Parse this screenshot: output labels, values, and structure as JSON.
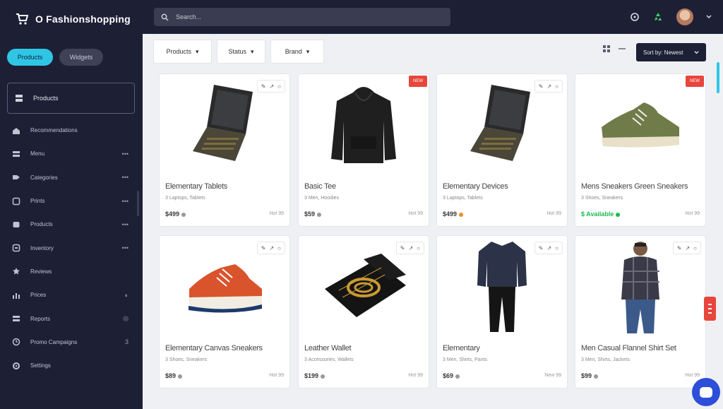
{
  "app": {
    "name": "O Fashionshopping"
  },
  "sidebar": {
    "pills": [
      {
        "label": "Products",
        "active": true
      },
      {
        "label": "Widgets",
        "active": false
      }
    ],
    "search_label": "Products",
    "items": [
      {
        "label": "Recommendations",
        "icon": "house-icon",
        "tail": ""
      },
      {
        "label": "Menu",
        "icon": "grid-icon",
        "tail": "•••"
      },
      {
        "label": "Categories",
        "icon": "tag-icon",
        "tail": "•••"
      },
      {
        "label": "Prints",
        "icon": "box-icon",
        "tail": "•••"
      },
      {
        "label": "Products",
        "icon": "layers-icon",
        "tail": "•••"
      },
      {
        "label": "Inventory",
        "icon": "archive-icon",
        "tail": "•••"
      },
      {
        "label": "Reviews",
        "icon": "star-icon",
        "tail": ""
      },
      {
        "label": "Prices",
        "icon": "chart-icon",
        "tail": "◐"
      },
      {
        "label": "Reports",
        "icon": "grid-icon",
        "tail": "◎"
      },
      {
        "label": "Promo Campaigns",
        "icon": "clock-icon",
        "tail": "3"
      },
      {
        "label": "Settings",
        "icon": "gear-icon",
        "tail": ""
      }
    ]
  },
  "topbar": {
    "search_placeholder": "Search...",
    "icons": [
      "notification-icon",
      "recycle-icon",
      "avatar",
      "chevron-down-icon"
    ]
  },
  "filters": [
    {
      "label": "Products",
      "arrow": "▾"
    },
    {
      "label": "Status",
      "arrow": "▾"
    },
    {
      "label": "Brand",
      "arrow": "▾"
    }
  ],
  "sort": {
    "label": "Sort by: Newest"
  },
  "colors": {
    "sidebar": "#1d1f35",
    "accent": "#2fc6e6",
    "badge": "#e8453c",
    "chat": "#2d4ed8",
    "price_green": "#1fba4e"
  },
  "products": [
    {
      "title": "Elementary Tablets",
      "sub": "3 Laptops, Tablets",
      "price": "$499",
      "meta": "Hot 99",
      "badge": "",
      "image": "laptop",
      "price_style": ""
    },
    {
      "title": "Basic Tee",
      "sub": "3 Men, Hoodies",
      "price": "$59",
      "meta": "Hot 99",
      "badge": "NEW",
      "image": "hoodie",
      "price_style": ""
    },
    {
      "title": "Elementary Devices",
      "sub": "3 Laptops, Tablets",
      "price": "$499",
      "meta": "Hot 99",
      "badge": "",
      "image": "laptop",
      "price_style": "orange"
    },
    {
      "title": "Mens Sneakers Green Sneakers",
      "sub": "3 Shoes, Sneakers",
      "price": "$ Available",
      "meta": "Hot 99",
      "badge": "NEW",
      "image": "sneaker-green",
      "price_style": "green"
    },
    {
      "title": "Elementary Canvas Sneakers",
      "sub": "3 Shoes, Sneakers",
      "price": "$89",
      "meta": "Hot 99",
      "badge": "",
      "image": "sneaker-red",
      "price_style": ""
    },
    {
      "title": "Leather Wallet",
      "sub": "3 Accessories, Wallets",
      "price": "$199",
      "meta": "Hot 99",
      "badge": "",
      "image": "wallet",
      "price_style": ""
    },
    {
      "title": "Elementary",
      "sub": "3 Men, Shirts, Pants",
      "price": "$69",
      "meta": "New 99",
      "badge": "",
      "image": "outfit",
      "price_style": ""
    },
    {
      "title": "Men Casual Flannel Shirt Set",
      "sub": "3 Men, Shirts, Jackets",
      "price": "$99",
      "meta": "Hot 99",
      "badge": "",
      "image": "model",
      "price_style": ""
    }
  ]
}
